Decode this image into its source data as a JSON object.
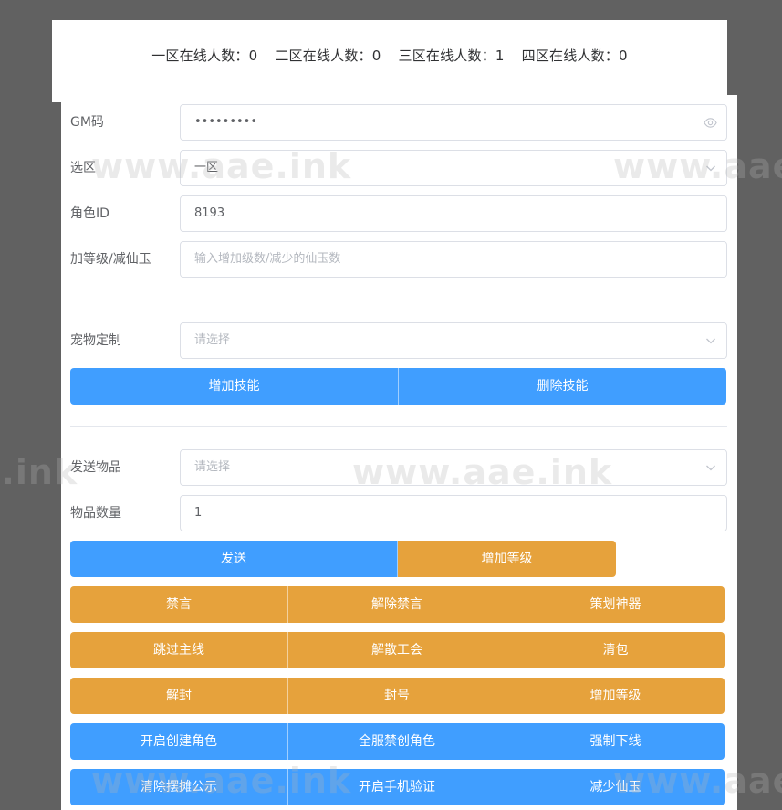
{
  "online": [
    {
      "label": "一区在线人数：0"
    },
    {
      "label": "二区在线人数：0"
    },
    {
      "label": "三区在线人数：1"
    },
    {
      "label": "四区在线人数：0"
    }
  ],
  "form": {
    "gm_label": "GM码",
    "gm_value": "•••••••••",
    "zone_label": "选区",
    "zone_value": "一区",
    "role_label": "角色ID",
    "role_value": "8193",
    "level_label": "加等级/减仙玉",
    "level_placeholder": "输入增加级数/减少的仙玉数",
    "pet_label": "宠物定制",
    "pet_placeholder": "请选择",
    "item_label": "发送物品",
    "item_placeholder": "请选择",
    "qty_label": "物品数量",
    "qty_value": "1"
  },
  "buttons": {
    "add_skill": "增加技能",
    "del_skill": "删除技能",
    "send": "发送",
    "add_level_1": "增加等级",
    "mute": "禁言",
    "unmute": "解除禁言",
    "planner_artifact": "策划神器",
    "skip_mainline": "跳过主线",
    "disband_guild": "解散工会",
    "clear_bag": "清包",
    "unban": "解封",
    "ban": "封号",
    "add_level_2": "增加等级",
    "enable_create_role": "开启创建角色",
    "server_ban_create": "全服禁创角色",
    "force_offline": "强制下线",
    "clear_stall": "清除摆摊公示",
    "enable_phone_verify": "开启手机验证",
    "reduce_jade": "减少仙玉"
  },
  "watermark": "www.aae.ink",
  "colors": {
    "primary": "#409eff",
    "warning": "#e6a23c",
    "backdrop": "#616161"
  },
  "icons": {
    "password": "eye-icon",
    "select": "chevron-down-icon"
  }
}
